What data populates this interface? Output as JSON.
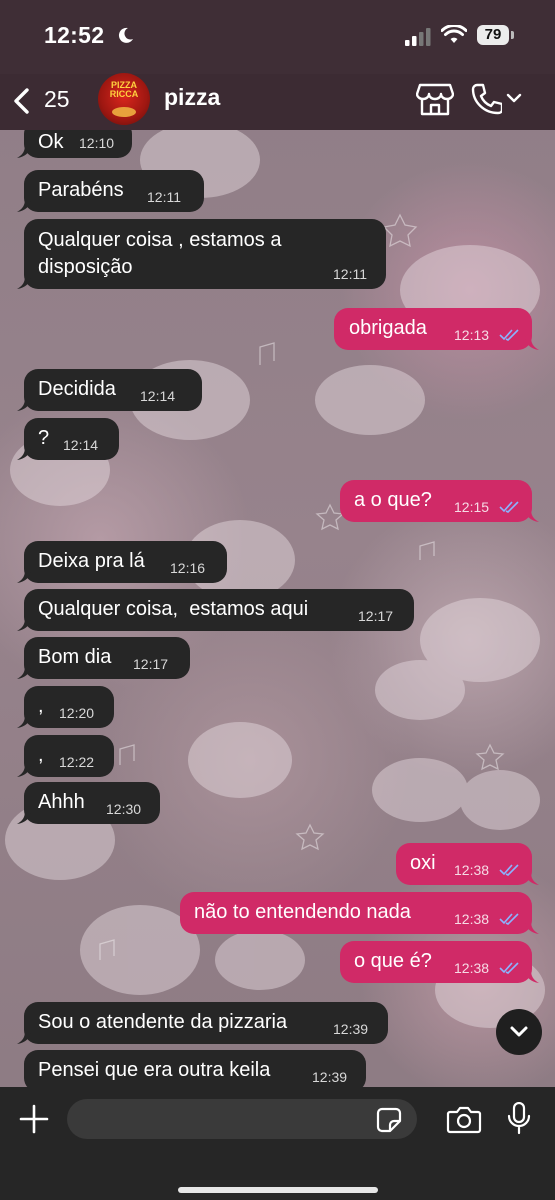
{
  "status_bar": {
    "time": "12:52",
    "battery": "79"
  },
  "header": {
    "back_count": "25",
    "contact_name": "pizza",
    "avatar_text": "PIZZA RICCA"
  },
  "messages": [
    {
      "dir": "in",
      "text": "Ok",
      "time": "12:10"
    },
    {
      "dir": "in",
      "text": "Parabéns",
      "time": "12:11"
    },
    {
      "dir": "in",
      "text_line1": "Qualquer coisa , estamos a",
      "text_line2": "disposição",
      "time": "12:11"
    },
    {
      "dir": "out",
      "text": "obrigada",
      "time": "12:13"
    },
    {
      "dir": "in",
      "text": "Decidida",
      "time": "12:14"
    },
    {
      "dir": "in",
      "text": "?",
      "time": "12:14"
    },
    {
      "dir": "out",
      "text": "a o que?",
      "time": "12:15"
    },
    {
      "dir": "in",
      "text": "Deixa pra lá",
      "time": "12:16"
    },
    {
      "dir": "in",
      "text": "Qualquer coisa,  estamos aqui",
      "time": "12:17"
    },
    {
      "dir": "in",
      "text": "Bom dia",
      "time": "12:17"
    },
    {
      "dir": "in",
      "text": ",",
      "time": "12:20"
    },
    {
      "dir": "in",
      "text": ",",
      "time": "12:22"
    },
    {
      "dir": "in",
      "text": "Ahhh",
      "time": "12:30"
    },
    {
      "dir": "out",
      "text": "oxi",
      "time": "12:38"
    },
    {
      "dir": "out",
      "text": "não to entendendo nada",
      "time": "12:38"
    },
    {
      "dir": "out",
      "text": "o que é?",
      "time": "12:38"
    },
    {
      "dir": "in",
      "text": "Sou o atendente da pizzaria",
      "time": "12:39"
    },
    {
      "dir": "in",
      "text": "Pensei que era outra keila",
      "time": "12:39"
    }
  ],
  "composer": {
    "placeholder": ""
  },
  "colors": {
    "incoming_bubble": "#262626",
    "outgoing_bubble": "#d02a67",
    "read_ticks": "#8ab4ff"
  }
}
